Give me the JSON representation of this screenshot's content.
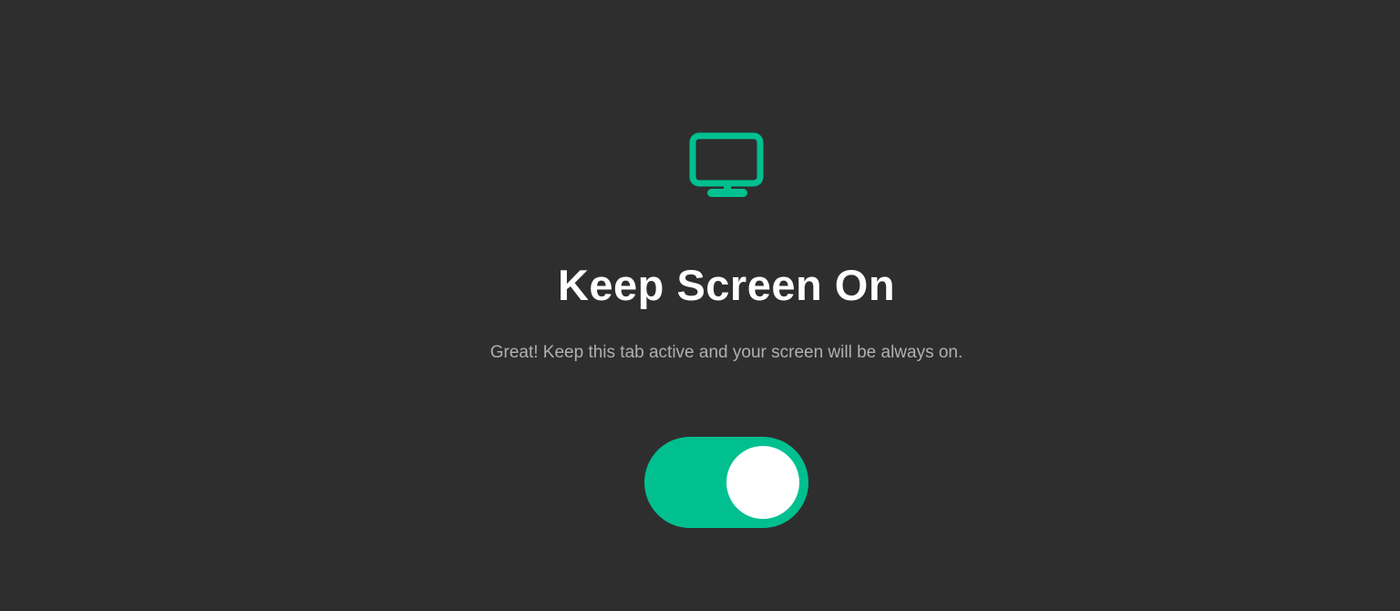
{
  "page": {
    "title": "Keep Screen On",
    "subtitle": "Great! Keep this tab active and your screen will be always on."
  },
  "icon": {
    "name": "monitor-icon"
  },
  "toggle": {
    "state": "on",
    "checked": true
  },
  "colors": {
    "background": "#2e2e2e",
    "accent": "#00c08f",
    "title": "#ffffff",
    "subtitle": "#b0b0b0",
    "knob": "#ffffff"
  }
}
